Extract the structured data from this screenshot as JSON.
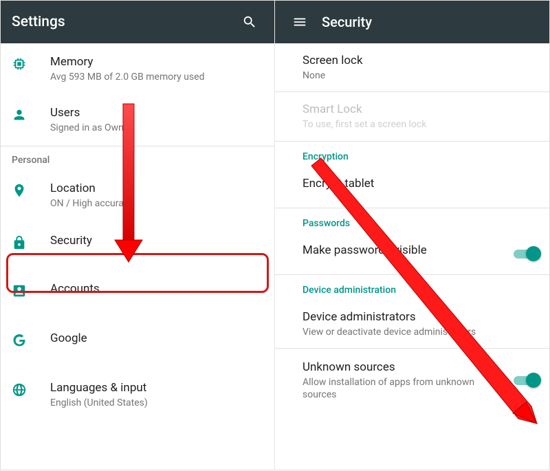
{
  "colors": {
    "accent": "#009688",
    "appbar": "#2d3a3f",
    "annotation": "#ff0000"
  },
  "left": {
    "appbar_title": "Settings",
    "items": [
      {
        "title": "Memory",
        "subtitle": "Avg 593 MB of 2.0 GB memory used"
      },
      {
        "title": "Users",
        "subtitle": "Signed in as Owner"
      }
    ],
    "section_personal": "Personal",
    "personal_items": [
      {
        "title": "Location",
        "subtitle": "ON / High accuracy"
      },
      {
        "title": "Security"
      },
      {
        "title": "Accounts"
      },
      {
        "title": "Google"
      },
      {
        "title": "Languages & input",
        "subtitle": "English (United States)"
      }
    ]
  },
  "right": {
    "appbar_title": "Security",
    "items": {
      "screen_lock": {
        "title": "Screen lock",
        "subtitle": "None"
      },
      "smart_lock": {
        "title": "Smart Lock",
        "subtitle": "To use, first set a screen lock"
      },
      "section_enc": "Encryption",
      "encrypt": {
        "title": "Encrypt tablet"
      },
      "section_pw": "Passwords",
      "make_pw": {
        "title": "Make passwords visible"
      },
      "section_admin": "Device administration",
      "dev_admin": {
        "title": "Device administrators",
        "subtitle": "View or deactivate device administrators"
      },
      "unknown": {
        "title": "Unknown sources",
        "subtitle": "Allow installation of apps from unknown sources"
      }
    }
  }
}
